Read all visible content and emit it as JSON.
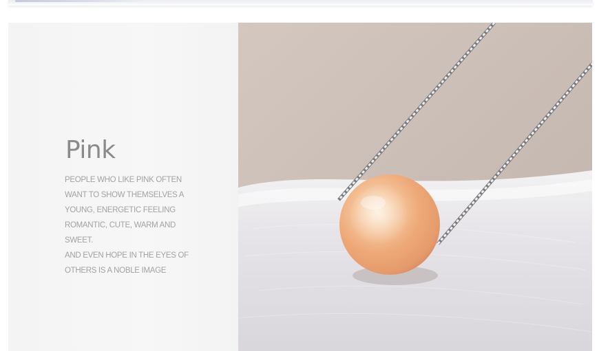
{
  "banner": {
    "color_name": "Pink",
    "description_lines": [
      "PEOPLE WHO LIKE PINK OFTEN",
      "WANT TO SHOW THEMSELVES A",
      "YOUNG, ENERGETIC FEELING",
      "ROMANTIC, CUTE, WARM AND",
      "SWEET.",
      "AND EVEN HOPE IN THE EYES OF",
      "OTHERS IS A NOBLE IMAGE"
    ]
  },
  "photo": {
    "subject": "pink pearl pendant on silver box chain",
    "pearl_color": "#f2b88a",
    "fabric_color": "#c9bdb6"
  }
}
